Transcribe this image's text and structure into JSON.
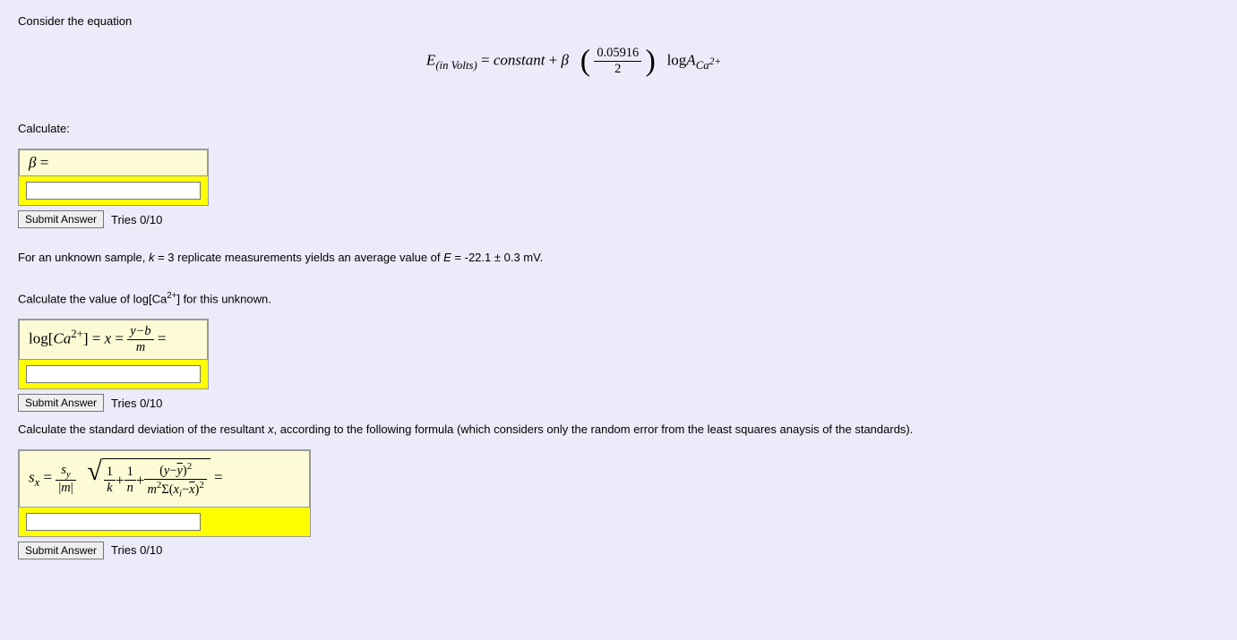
{
  "intro": "Consider the equation",
  "equation": {
    "lhs_E": "E",
    "lhs_sub": "(in Volts)",
    "eq": " = ",
    "constant": "constant",
    "plus": " + ",
    "beta": "β",
    "frac_num": "0.05916",
    "frac_den": "2",
    "log": "log",
    "A": "A",
    "A_sub_ca": "Ca",
    "A_sub_sup": "2+"
  },
  "calculate_label": "Calculate:",
  "q1": {
    "formula_beta": "β",
    "formula_eq": " ="
  },
  "submit_label": "Submit Answer",
  "tries_label": "Tries 0/10",
  "q2_intro_a": "For an unknown sample, ",
  "q2_k": "k",
  "q2_intro_b": " = 3 replicate measurements yields an average value of ",
  "q2_E": "E",
  "q2_intro_c": " = -22.1 ± 0.3 mV.",
  "q2_calc_a": "Calculate the value of log[Ca",
  "q2_calc_sup": "2+",
  "q2_calc_b": "] for this unknown.",
  "q2": {
    "f_log": "log",
    "f_lbracket": "[",
    "f_ca": "Ca",
    "f_sup": "2+",
    "f_rbracket": "]",
    "f_eq1": " = ",
    "f_x": "x",
    "f_eq2": " = ",
    "f_num": "y−b",
    "f_den": "m",
    "f_eq3": " ="
  },
  "q3_intro_a": "Calculate the standard deviation of the resultant ",
  "q3_x": "x",
  "q3_intro_b": ", according to the following formula (which considers only the random error from the least squares anaysis of the standards).",
  "q3": {
    "sx_s": "s",
    "sx_x": "x",
    "eq1": " = ",
    "frac1_num_s": "s",
    "frac1_num_y": "y",
    "frac1_den_lpipe": "|",
    "frac1_den_m": "m",
    "frac1_den_rpipe": "|",
    "sqrt_frac1_num": "1",
    "sqrt_frac1_den": "k",
    "plus1": " + ",
    "sqrt_frac2_num": "1",
    "sqrt_frac2_den": "n",
    "plus2": " + ",
    "big_num_open": "(",
    "big_num_y": "y",
    "big_num_minus": "−",
    "big_num_ybar": "y",
    "big_num_close": ")",
    "big_num_sup": "2",
    "big_den_m": "m",
    "big_den_msup": "2",
    "big_den_sigma": "Σ(",
    "big_den_xi": "x",
    "big_den_i": "i",
    "big_den_minus": "−",
    "big_den_xbar": "x",
    "big_den_close": ")",
    "big_den_sup": "2",
    "eq2": " ="
  }
}
